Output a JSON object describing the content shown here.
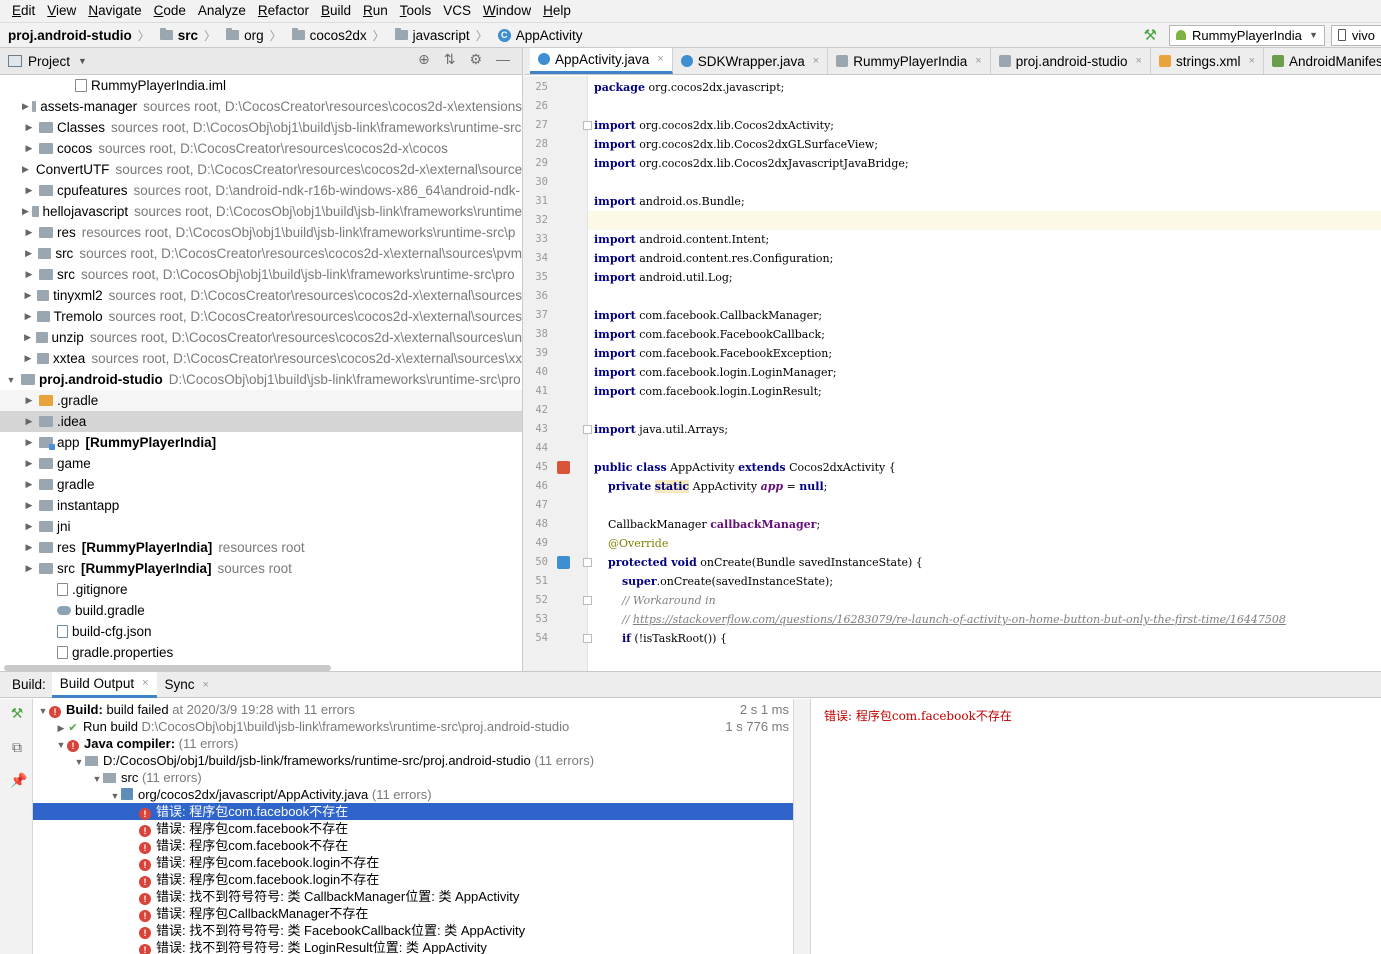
{
  "menu": [
    {
      "label": "Edit",
      "mn": "E",
      "rest": "dit"
    },
    {
      "label": "View",
      "mn": "V",
      "rest": "iew"
    },
    {
      "label": "Navigate",
      "mn": "N",
      "rest": "avigate"
    },
    {
      "label": "Code",
      "mn": "C",
      "rest": "ode"
    },
    {
      "label": "Analyze",
      "mn": "",
      "rest": "Analyze"
    },
    {
      "label": "Refactor",
      "mn": "R",
      "rest": "efactor"
    },
    {
      "label": "Build",
      "mn": "B",
      "rest": "uild"
    },
    {
      "label": "Run",
      "mn": "R",
      "rest": "un"
    },
    {
      "label": "Tools",
      "mn": "T",
      "rest": "ools"
    },
    {
      "label": "VCS",
      "mn": "",
      "rest": "VCS"
    },
    {
      "label": "Window",
      "mn": "W",
      "rest": "indow"
    },
    {
      "label": "Help",
      "mn": "H",
      "rest": "elp"
    }
  ],
  "breadcrumb": {
    "project": "proj.android-studio",
    "src": "src",
    "org": "org",
    "cocos": "cocos2dx",
    "js": "javascript",
    "file": "AppActivity"
  },
  "run_config": "RummyPlayerIndia",
  "device": "vivo",
  "project_panel": {
    "title": "Project",
    "rows": [
      {
        "indent": 3,
        "arrow": "",
        "icon": "iml",
        "name": "RummyPlayerIndia.iml",
        "bold": false,
        "sub": "",
        "sel": false
      },
      {
        "indent": 1,
        "arrow": "▶",
        "icon": "folder",
        "name": "assets-manager",
        "bold": false,
        "sub": "sources root,  D:\\CocosCreator\\resources\\cocos2d-x\\extensions",
        "sel": false
      },
      {
        "indent": 1,
        "arrow": "▶",
        "icon": "folder",
        "name": "Classes",
        "bold": false,
        "sub": "sources root,  D:\\CocosObj\\obj1\\build\\jsb-link\\frameworks\\runtime-src",
        "sel": false
      },
      {
        "indent": 1,
        "arrow": "▶",
        "icon": "folder",
        "name": "cocos",
        "bold": false,
        "sub": "sources root,  D:\\CocosCreator\\resources\\cocos2d-x\\cocos",
        "sel": false
      },
      {
        "indent": 1,
        "arrow": "▶",
        "icon": "folder",
        "name": "ConvertUTF",
        "bold": false,
        "sub": "sources root,  D:\\CocosCreator\\resources\\cocos2d-x\\external\\sources",
        "sel": false
      },
      {
        "indent": 1,
        "arrow": "▶",
        "icon": "folder",
        "name": "cpufeatures",
        "bold": false,
        "sub": "sources root,  D:\\android-ndk-r16b-windows-x86_64\\android-ndk-",
        "sel": false
      },
      {
        "indent": 1,
        "arrow": "▶",
        "icon": "folder",
        "name": "hellojavascript",
        "bold": false,
        "sub": "sources root,  D:\\CocosObj\\obj1\\build\\jsb-link\\frameworks\\runtime",
        "sel": false
      },
      {
        "indent": 1,
        "arrow": "▶",
        "icon": "folder",
        "name": "res",
        "bold": false,
        "sub": "resources root,  D:\\CocosObj\\obj1\\build\\jsb-link\\frameworks\\runtime-src\\p",
        "sel": false
      },
      {
        "indent": 1,
        "arrow": "▶",
        "icon": "folder",
        "name": "src",
        "bold": false,
        "sub": "sources root,  D:\\CocosCreator\\resources\\cocos2d-x\\external\\sources\\pvm",
        "sel": false
      },
      {
        "indent": 1,
        "arrow": "▶",
        "icon": "folder",
        "name": "src",
        "bold": false,
        "sub": "sources root,  D:\\CocosObj\\obj1\\build\\jsb-link\\frameworks\\runtime-src\\pro",
        "sel": false
      },
      {
        "indent": 1,
        "arrow": "▶",
        "icon": "folder",
        "name": "tinyxml2",
        "bold": false,
        "sub": "sources root,  D:\\CocosCreator\\resources\\cocos2d-x\\external\\sources",
        "sel": false
      },
      {
        "indent": 1,
        "arrow": "▶",
        "icon": "folder",
        "name": "Tremolo",
        "bold": false,
        "sub": "sources root,  D:\\CocosCreator\\resources\\cocos2d-x\\external\\sources",
        "sel": false
      },
      {
        "indent": 1,
        "arrow": "▶",
        "icon": "folder",
        "name": "unzip",
        "bold": false,
        "sub": "sources root,  D:\\CocosCreator\\resources\\cocos2d-x\\external\\sources\\un",
        "sel": false
      },
      {
        "indent": 1,
        "arrow": "▶",
        "icon": "folder",
        "name": "xxtea",
        "bold": false,
        "sub": "sources root,  D:\\CocosCreator\\resources\\cocos2d-x\\external\\sources\\xx",
        "sel": false
      },
      {
        "indent": 0,
        "arrow": "▼",
        "icon": "folder",
        "name": "proj.android-studio",
        "bold": true,
        "sub": "D:\\CocosObj\\obj1\\build\\jsb-link\\frameworks\\runtime-src\\pro",
        "sel": false
      },
      {
        "indent": 1,
        "arrow": "▶",
        "icon": "orange",
        "name": ".gradle",
        "bold": false,
        "sub": "",
        "sel": false,
        "hl": true
      },
      {
        "indent": 1,
        "arrow": "▶",
        "icon": "folder",
        "name": ".idea",
        "bold": false,
        "sub": "",
        "sel": true
      },
      {
        "indent": 1,
        "arrow": "▶",
        "icon": "mod",
        "name": "app",
        "bold": false,
        "tag": "[RummyPlayerIndia]",
        "sub": "",
        "sel": false
      },
      {
        "indent": 1,
        "arrow": "▶",
        "icon": "folder",
        "name": "game",
        "bold": false,
        "sub": "",
        "sel": false
      },
      {
        "indent": 1,
        "arrow": "▶",
        "icon": "folder",
        "name": "gradle",
        "bold": false,
        "sub": "",
        "sel": false
      },
      {
        "indent": 1,
        "arrow": "▶",
        "icon": "folder",
        "name": "instantapp",
        "bold": false,
        "sub": "",
        "sel": false
      },
      {
        "indent": 1,
        "arrow": "▶",
        "icon": "folder",
        "name": "jni",
        "bold": false,
        "sub": "",
        "sel": false
      },
      {
        "indent": 1,
        "arrow": "▶",
        "icon": "folder",
        "name": "res",
        "bold": false,
        "tag": "[RummyPlayerIndia]",
        "sub": "resources root",
        "sel": false
      },
      {
        "indent": 1,
        "arrow": "▶",
        "icon": "folder",
        "name": "src",
        "bold": false,
        "tag": "[RummyPlayerIndia]",
        "sub": "sources root",
        "sel": false
      },
      {
        "indent": 2,
        "arrow": "",
        "icon": "file",
        "name": ".gitignore",
        "bold": false,
        "sub": "",
        "sel": false
      },
      {
        "indent": 2,
        "arrow": "",
        "icon": "gradle",
        "name": "build.gradle",
        "bold": false,
        "sub": "",
        "sel": false
      },
      {
        "indent": 2,
        "arrow": "",
        "icon": "json",
        "name": "build-cfg.json",
        "bold": false,
        "sub": "",
        "sel": false
      },
      {
        "indent": 2,
        "arrow": "",
        "icon": "file",
        "name": "gradle.properties",
        "bold": false,
        "sub": "",
        "sel": false
      }
    ]
  },
  "editor_tabs": [
    {
      "label": "AppActivity.java",
      "icon": "c",
      "active": true
    },
    {
      "label": "SDKWrapper.java",
      "icon": "c",
      "active": false
    },
    {
      "label": "RummyPlayerIndia",
      "icon": "g",
      "active": false
    },
    {
      "label": "proj.android-studio",
      "icon": "g",
      "active": false
    },
    {
      "label": "strings.xml",
      "icon": "x2",
      "active": false
    },
    {
      "label": "AndroidManifest.x",
      "icon": "mf",
      "active": false
    }
  ],
  "code": [
    {
      "n": "25",
      "html": "<span class=\"kw\">package</span> org.cocos2dx.javascript;"
    },
    {
      "n": "26",
      "html": ""
    },
    {
      "n": "27",
      "html": "<span class=\"kw\">import</span> org.cocos2dx.lib.Cocos2dxActivity;",
      "fold": true
    },
    {
      "n": "28",
      "html": "<span class=\"kw\">import</span> org.cocos2dx.lib.Cocos2dxGLSurfaceView;"
    },
    {
      "n": "29",
      "html": "<span class=\"kw\">import</span> org.cocos2dx.lib.Cocos2dxJavascriptJavaBridge;"
    },
    {
      "n": "30",
      "html": ""
    },
    {
      "n": "31",
      "html": "<span class=\"kw\">import</span> android.os.Bundle;"
    },
    {
      "n": "32",
      "html": "",
      "cur": true
    },
    {
      "n": "33",
      "html": "<span class=\"kw\">import</span> android.content.Intent;"
    },
    {
      "n": "34",
      "html": "<span class=\"kw\">import</span> android.content.res.Configuration;"
    },
    {
      "n": "35",
      "html": "<span class=\"kw\">import</span> android.util.Log;"
    },
    {
      "n": "36",
      "html": ""
    },
    {
      "n": "37",
      "html": "<span class=\"kw\">import</span> com.facebook.CallbackManager;"
    },
    {
      "n": "38",
      "html": "<span class=\"kw\">import</span> com.facebook.FacebookCallback;"
    },
    {
      "n": "39",
      "html": "<span class=\"kw\">import</span> com.facebook.FacebookException;"
    },
    {
      "n": "40",
      "html": "<span class=\"kw\">import</span> com.facebook.login.LoginManager;"
    },
    {
      "n": "41",
      "html": "<span class=\"kw\">import</span> com.facebook.login.LoginResult;"
    },
    {
      "n": "42",
      "html": ""
    },
    {
      "n": "43",
      "html": "<span class=\"kw\">import</span> java.util.Arrays;",
      "fold": true
    },
    {
      "n": "44",
      "html": ""
    },
    {
      "n": "45",
      "html": "<span class=\"kw\">public class</span> AppActivity <span class=\"kw\">extends</span> Cocos2dxActivity {"
    },
    {
      "n": "46",
      "html": "    <span class=\"kw\">private</span> <span class=\"kw statichl\">static</span> AppActivity <span class=\"fldi\">app</span> = <span class=\"kw\">null</span>;"
    },
    {
      "n": "47",
      "html": ""
    },
    {
      "n": "48",
      "html": "    CallbackManager <span class=\"fld\">callbackManager</span>;"
    },
    {
      "n": "49",
      "html": "    <span class=\"ann\">@Override</span>"
    },
    {
      "n": "50",
      "html": "    <span class=\"kw\">protected void</span> onCreate(Bundle savedInstanceState) {",
      "fold": true
    },
    {
      "n": "51",
      "html": "        <span class=\"kw\">super</span>.onCreate(savedInstanceState);"
    },
    {
      "n": "52",
      "html": "        <span class=\"cmt\">// Workaround in</span>",
      "fold": true
    },
    {
      "n": "53",
      "html": "        <span class=\"cmt\">// </span><span class=\"url\">https://stackoverflow.com/questions/16283079/re-launch-of-activity-on-home-button-but-only-the-first-time/16447508</span>"
    },
    {
      "n": "54",
      "html": "        <span class=\"kw\">if</span> (!isTaskRoot()) {",
      "fold": true
    }
  ],
  "build": {
    "label": "Build:",
    "tab_output": "Build Output",
    "tab_sync": "Sync",
    "detail_message": "错误: 程序包com.facebook不存在",
    "rows": [
      {
        "lvl": 0,
        "arrow": "▼",
        "icon": "err",
        "bold": "Build:",
        "text": " build failed",
        "sub": " at 2020/3/9 19:28  with 11 errors",
        "time": "2 s 1 ms"
      },
      {
        "lvl": 1,
        "arrow": "▶",
        "icon": "ok",
        "bold": "",
        "text": "Run build ",
        "sub": "D:\\CocosObj\\obj1\\build\\jsb-link\\frameworks\\runtime-src\\proj.android-studio",
        "time": "1 s 776 ms"
      },
      {
        "lvl": 1,
        "arrow": "▼",
        "icon": "err",
        "bold": "Java compiler:",
        "text": "",
        "sub": " (11 errors)",
        "time": ""
      },
      {
        "lvl": 2,
        "arrow": "▼",
        "icon": "folder",
        "bold": "",
        "text": "D:/CocosObj/obj1/build/jsb-link/frameworks/runtime-src/proj.android-studio",
        "sub": "  (11 errors)",
        "time": ""
      },
      {
        "lvl": 3,
        "arrow": "▼",
        "icon": "folder",
        "bold": "",
        "text": "src",
        "sub": "  (11 errors)",
        "time": ""
      },
      {
        "lvl": 4,
        "arrow": "▼",
        "icon": "file",
        "bold": "",
        "text": "org/cocos2dx/javascript/AppActivity.java",
        "sub": "  (11 errors)",
        "time": ""
      },
      {
        "lvl": 5,
        "arrow": "",
        "icon": "err",
        "bold": "",
        "text": "错误: 程序包com.facebook不存在",
        "sub": "",
        "time": "",
        "sel": true
      },
      {
        "lvl": 5,
        "arrow": "",
        "icon": "err",
        "bold": "",
        "text": "错误: 程序包com.facebook不存在",
        "sub": "",
        "time": ""
      },
      {
        "lvl": 5,
        "arrow": "",
        "icon": "err",
        "bold": "",
        "text": "错误: 程序包com.facebook不存在",
        "sub": "",
        "time": ""
      },
      {
        "lvl": 5,
        "arrow": "",
        "icon": "err",
        "bold": "",
        "text": "错误: 程序包com.facebook.login不存在",
        "sub": "",
        "time": ""
      },
      {
        "lvl": 5,
        "arrow": "",
        "icon": "err",
        "bold": "",
        "text": "错误: 程序包com.facebook.login不存在",
        "sub": "",
        "time": ""
      },
      {
        "lvl": 5,
        "arrow": "",
        "icon": "err",
        "bold": "",
        "text": "错误: 找不到符号符号:   类 CallbackManager位置: 类 AppActivity",
        "sub": "",
        "time": ""
      },
      {
        "lvl": 5,
        "arrow": "",
        "icon": "err",
        "bold": "",
        "text": "错误: 程序包CallbackManager不存在",
        "sub": "",
        "time": ""
      },
      {
        "lvl": 5,
        "arrow": "",
        "icon": "err",
        "bold": "",
        "text": "错误: 找不到符号符号:   类 FacebookCallback位置: 类 AppActivity",
        "sub": "",
        "time": ""
      },
      {
        "lvl": 5,
        "arrow": "",
        "icon": "err",
        "bold": "",
        "text": "错误: 找不到符号符号:   类 LoginResult位置: 类 AppActivity",
        "sub": "",
        "time": ""
      }
    ]
  }
}
